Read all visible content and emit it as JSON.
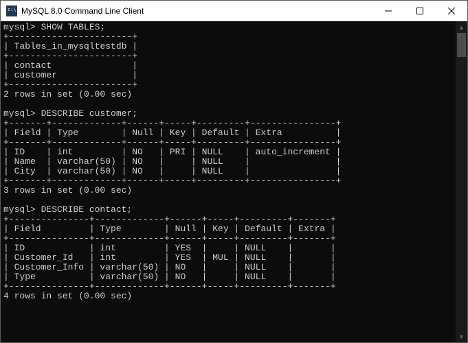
{
  "window": {
    "title": "MySQL 8.0 Command Line Client"
  },
  "session": {
    "prompt": "mysql>",
    "cmd_show_tables": "SHOW TABLES;",
    "cmd_describe_customer": "DESCRIBE customer;",
    "cmd_describe_contact": "DESCRIBE contact;",
    "show_tables": {
      "header": "Tables_in_mysqltestdb",
      "rows": [
        "contact",
        "customer"
      ],
      "footer": "2 rows in set (0.00 sec)"
    },
    "describe_customer": {
      "headers": [
        "Field",
        "Type",
        "Null",
        "Key",
        "Default",
        "Extra"
      ],
      "rows": [
        {
          "Field": "ID",
          "Type": "int",
          "Null": "NO",
          "Key": "PRI",
          "Default": "NULL",
          "Extra": "auto_increment"
        },
        {
          "Field": "Name",
          "Type": "varchar(50)",
          "Null": "NO",
          "Key": "",
          "Default": "NULL",
          "Extra": ""
        },
        {
          "Field": "City",
          "Type": "varchar(50)",
          "Null": "NO",
          "Key": "",
          "Default": "NULL",
          "Extra": ""
        }
      ],
      "footer": "3 rows in set (0.00 sec)"
    },
    "describe_contact": {
      "headers": [
        "Field",
        "Type",
        "Null",
        "Key",
        "Default",
        "Extra"
      ],
      "rows": [
        {
          "Field": "ID",
          "Type": "int",
          "Null": "YES",
          "Key": "",
          "Default": "NULL",
          "Extra": ""
        },
        {
          "Field": "Customer_Id",
          "Type": "int",
          "Null": "YES",
          "Key": "MUL",
          "Default": "NULL",
          "Extra": ""
        },
        {
          "Field": "Customer_Info",
          "Type": "varchar(50)",
          "Null": "NO",
          "Key": "",
          "Default": "NULL",
          "Extra": ""
        },
        {
          "Field": "Type",
          "Type": "varchar(50)",
          "Null": "NO",
          "Key": "",
          "Default": "NULL",
          "Extra": ""
        }
      ],
      "footer": "4 rows in set (0.00 sec)"
    }
  }
}
